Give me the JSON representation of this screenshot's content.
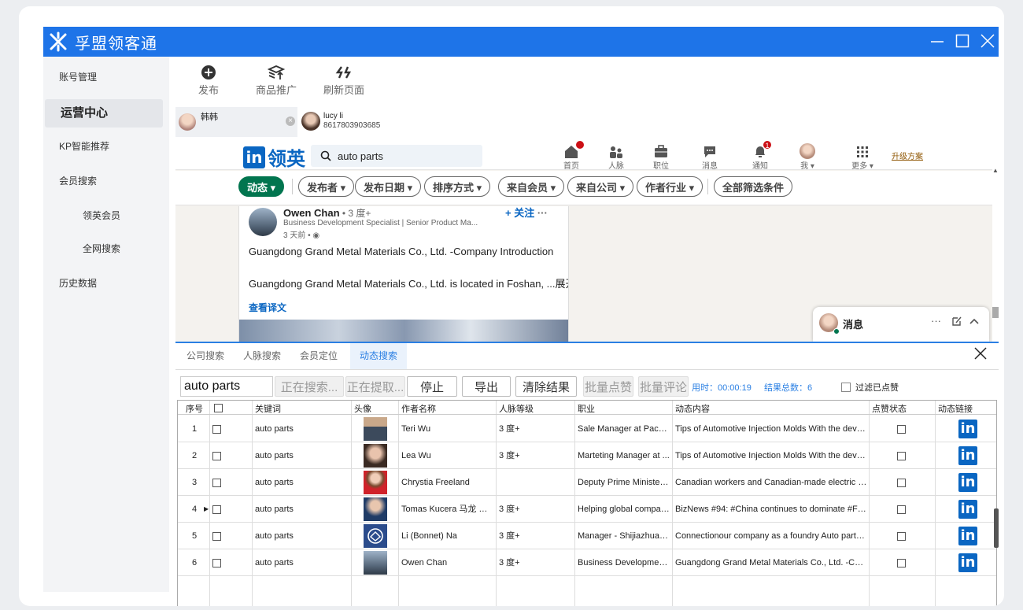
{
  "app": {
    "title": "孚盟领客通"
  },
  "sidebar": {
    "items": [
      {
        "label": "账号管理"
      },
      {
        "label": "运营中心"
      },
      {
        "label": "KP智能推荐"
      },
      {
        "label": "会员搜索"
      },
      {
        "label": "领英会员"
      },
      {
        "label": "全网搜索"
      },
      {
        "label": "历史数据"
      }
    ]
  },
  "toolbar": {
    "publish": "发布",
    "promote": "商品推广",
    "refresh": "刷新页面"
  },
  "accounts": [
    {
      "name": "韩韩"
    },
    {
      "name": "lucy li",
      "phone": "8617803903685"
    }
  ],
  "linkedin": {
    "brand": "领英",
    "search_value": "auto parts",
    "nav": [
      {
        "label": "首页",
        "icon": "home-icon"
      },
      {
        "label": "人脉",
        "icon": "network-icon"
      },
      {
        "label": "职位",
        "icon": "briefcase-icon"
      },
      {
        "label": "消息",
        "icon": "message-icon"
      },
      {
        "label": "通知",
        "icon": "bell-icon",
        "badge": "1"
      },
      {
        "label": "我 ▾",
        "icon": "avatar"
      },
      {
        "label": "更多 ▾",
        "icon": "grid-icon"
      }
    ],
    "upgrade": "升级方案",
    "filters": [
      "动态 ▾",
      "发布者 ▾",
      "发布日期 ▾",
      "排序方式 ▾",
      "来自会员 ▾",
      "来自公司 ▾",
      "作者行业 ▾",
      "全部筛选条件"
    ],
    "post": {
      "author": "Owen Chan",
      "degree": " • 3 度+",
      "headline": "Business Development Specialist | Senior Product Ma...",
      "time": "3 天前 • ",
      "follow": "+ 关注",
      "more": "···",
      "line1": "Guangdong Grand Metal Materials Co., Ltd. -Company Introduction",
      "line2": "Guangdong Grand Metal Materials Co., Ltd. is located in Foshan, ...展开",
      "translate": "查看译文"
    },
    "messages": {
      "title": "消息",
      "more": "···"
    }
  },
  "search_tabs": [
    "公司搜索",
    "人脉搜索",
    "会员定位",
    "动态搜索"
  ],
  "controls": {
    "keyword": "auto parts",
    "searching": "正在搜索...",
    "extracting": "正在提取...",
    "stop": "停止",
    "export": "导出",
    "clear": "清除结果",
    "batch_like": "批量点赞",
    "batch_comment": "批量评论",
    "elapsed": "用时：00:00:19",
    "total": "结果总数：6",
    "filter_liked": "过滤已点赞"
  },
  "table": {
    "headers": [
      "序号",
      "",
      "关键词",
      "头像",
      "作者名称",
      "人脉等级",
      "职业",
      "动态内容",
      "点赞状态",
      "动态链接"
    ],
    "rows": [
      {
        "no": "1",
        "keyword": "auto parts",
        "name": "Teri Wu",
        "level": "3 度+",
        "job": "Sale Manager at Packso...",
        "content": "Tips of Automotive Injection Molds With the devel..."
      },
      {
        "no": "2",
        "keyword": "auto parts",
        "name": "Lea Wu",
        "level": "3 度+",
        "job": "Marteting Manager at ...",
        "content": "Tips of Automotive Injection Molds With the devel..."
      },
      {
        "no": "3",
        "keyword": "auto parts",
        "name": "Chrystia Freeland",
        "level": "",
        "job": "Deputy Prime Minister ...",
        "content": "Canadian workers and Canadian-made electric ve..."
      },
      {
        "no": "4",
        "keyword": "auto parts",
        "name": "Tomas Kucera 马龙 MB...",
        "level": "3 度+",
        "job": "Helping global compani...",
        "content": "BizNews #94: #China continues to dominate #Fort..."
      },
      {
        "no": "5",
        "keyword": "auto parts",
        "name": "Li (Bonnet) Na",
        "level": "3 度+",
        "job": "Manager - Shijiazhuang...",
        "content": "Connectionour company as a foundry Auto parts ..."
      },
      {
        "no": "6",
        "keyword": "auto parts",
        "name": "Owen Chan",
        "level": "3 度+",
        "job": "Business Development ...",
        "content": "Guangdong Grand Metal Materials Co., Ltd. -Com..."
      }
    ],
    "link_label": "in"
  },
  "colors": {
    "brand_blue": "#1e74e8",
    "linkedin_blue": "#0a66c2",
    "linkedin_green": "#01754f"
  }
}
